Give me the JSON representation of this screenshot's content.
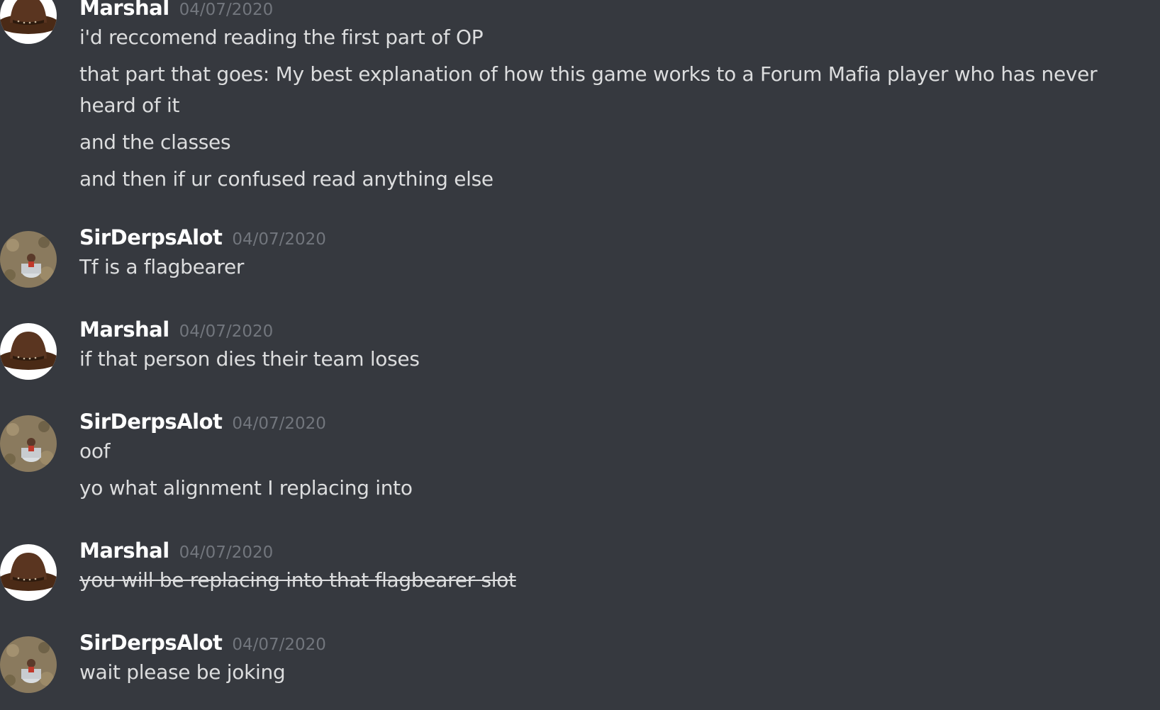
{
  "users": {
    "marshal": "Marshal",
    "sirderps": "SirDerpsAlot"
  },
  "groups": [
    {
      "author": "Marshal",
      "avatar_icon": "cowboy-hat-avatar-icon",
      "timestamp": "04/07/2020",
      "messages": [
        {
          "text": "i'd reccomend reading the first part of OP",
          "strikethrough": false
        },
        {
          "text": "that part that goes: My best explanation of how this game works to a Forum Mafia player who has never heard of it",
          "strikethrough": false
        },
        {
          "text": "and the classes",
          "strikethrough": false
        },
        {
          "text": "and then if ur confused read anything else",
          "strikethrough": false
        }
      ]
    },
    {
      "author": "SirDerpsAlot",
      "avatar_icon": "bucket-person-avatar-icon",
      "timestamp": "04/07/2020",
      "messages": [
        {
          "text": "Tf is a flagbearer",
          "strikethrough": false
        }
      ]
    },
    {
      "author": "Marshal",
      "avatar_icon": "cowboy-hat-avatar-icon",
      "timestamp": "04/07/2020",
      "messages": [
        {
          "text": "if that person dies their team loses",
          "strikethrough": false
        }
      ]
    },
    {
      "author": "SirDerpsAlot",
      "avatar_icon": "bucket-person-avatar-icon",
      "timestamp": "04/07/2020",
      "messages": [
        {
          "text": "oof",
          "strikethrough": false
        },
        {
          "text": "yo what alignment I replacing into",
          "strikethrough": false
        }
      ]
    },
    {
      "author": "Marshal",
      "avatar_icon": "cowboy-hat-avatar-icon",
      "timestamp": "04/07/2020",
      "messages": [
        {
          "text": "you will be replacing into that flagbearer slot",
          "strikethrough": true
        }
      ]
    },
    {
      "author": "SirDerpsAlot",
      "avatar_icon": "bucket-person-avatar-icon",
      "timestamp": "04/07/2020",
      "messages": [
        {
          "text": "wait please be joking",
          "strikethrough": false
        }
      ]
    }
  ],
  "colors": {
    "background": "#36393f",
    "username": "#ffffff",
    "timestamp": "#72767d",
    "message_text": "#dcddde"
  }
}
